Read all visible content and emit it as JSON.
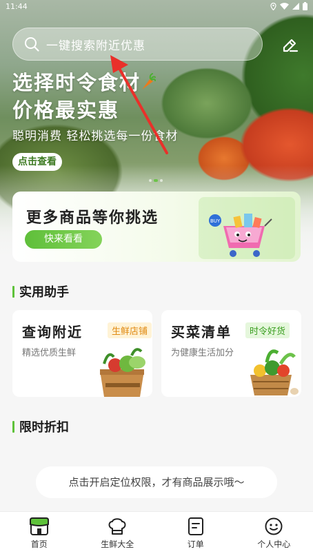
{
  "status_bar": {
    "time": "11:44"
  },
  "search": {
    "placeholder": "一键搜索附近优惠"
  },
  "banner": {
    "title_line1": "选择时令食材",
    "title_line2": "价格最实惠",
    "subtitle": "聪明消费 轻松挑选每一份食材",
    "button": "点击查看"
  },
  "promo": {
    "title": "更多商品等你挑选",
    "button": "快来看看"
  },
  "helpers": {
    "title": "实用助手",
    "cards": [
      {
        "title": "查询附近",
        "tag": "生鲜店铺",
        "subtitle": "精选优质生鲜"
      },
      {
        "title": "买菜清单",
        "tag": "时令好货",
        "subtitle": "为健康生活加分"
      }
    ]
  },
  "discount": {
    "title": "限时折扣",
    "location_tip": "点击开启定位权限，才有商品展示哦～"
  },
  "bottom_nav": [
    {
      "label": "首页",
      "icon": "shop-icon",
      "active": true
    },
    {
      "label": "生鲜大全",
      "icon": "chef-hat-icon"
    },
    {
      "label": "订单",
      "icon": "order-list-icon"
    },
    {
      "label": "个人中心",
      "icon": "smiley-face-icon"
    }
  ],
  "colors": {
    "accent": "#5ec23a",
    "tag_orange_bg": "#fff3d6",
    "tag_orange_text": "#e08a12",
    "tag_green_bg": "#e5f7dc",
    "tag_green_text": "#3a9e20"
  }
}
